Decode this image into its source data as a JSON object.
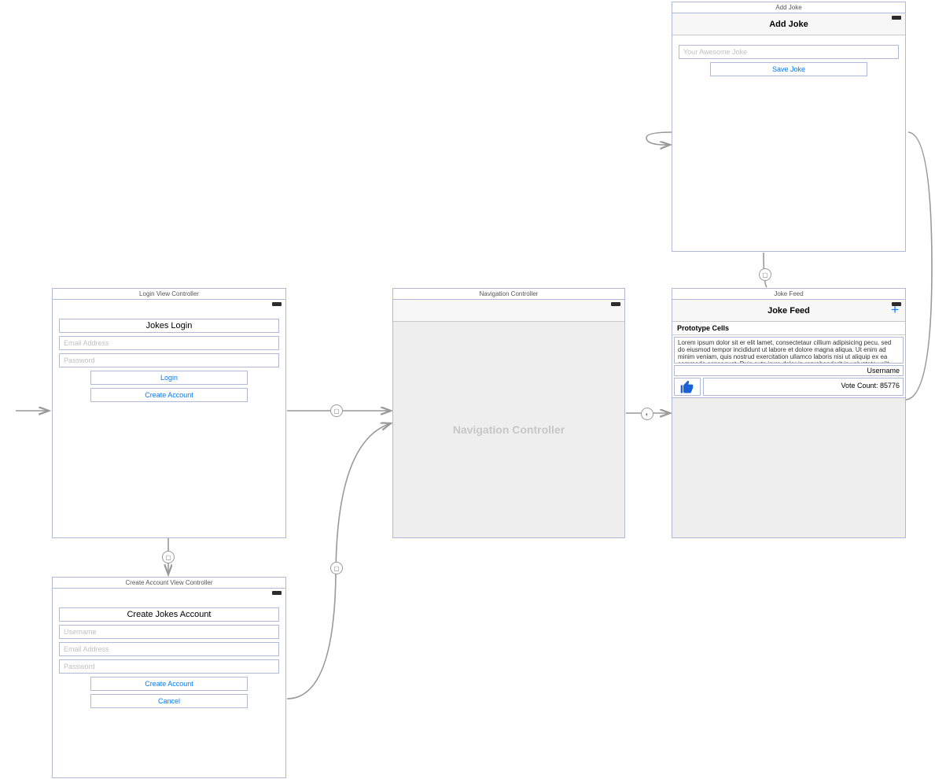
{
  "scenes": {
    "login": {
      "title": "Login View Controller",
      "header": "Jokes Login",
      "email_ph": "Email Address",
      "password_ph": "Password",
      "login_btn": "Login",
      "create_btn": "Create Account"
    },
    "createAccount": {
      "title": "Create Account View Controller",
      "header": "Create Jokes Account",
      "username_ph": "Username",
      "email_ph": "Email Address",
      "password_ph": "Password",
      "create_btn": "Create Account",
      "cancel_btn": "Cancel"
    },
    "nav": {
      "title": "Navigation Controller",
      "placeholder": "Navigation Controller"
    },
    "jokeFeed": {
      "title": "Joke Feed",
      "nav_title": "Joke Feed",
      "proto_header": "Prototype Cells",
      "lorem": "Lorem ipsum dolor sit er elit lamet, consectetaur cillium adipisicing pecu, sed do eiusmod tempor incididunt ut labore et dolore magna aliqua. Ut enim ad minim veniam, quis nostrud exercitation ullamco laboris nisi ut aliquip ex ea commodo consequat. Duis aute irure dolor in reprehenderit in voluptate velit esse cillum dolore eu fugiat nulla",
      "username": "Username",
      "vote_label": "Vote Count: 85776"
    },
    "addJoke": {
      "title": "Add Joke",
      "nav_title": "Add Joke",
      "placeholder": "Your Awesome Joke",
      "save_btn": "Save Joke"
    }
  }
}
